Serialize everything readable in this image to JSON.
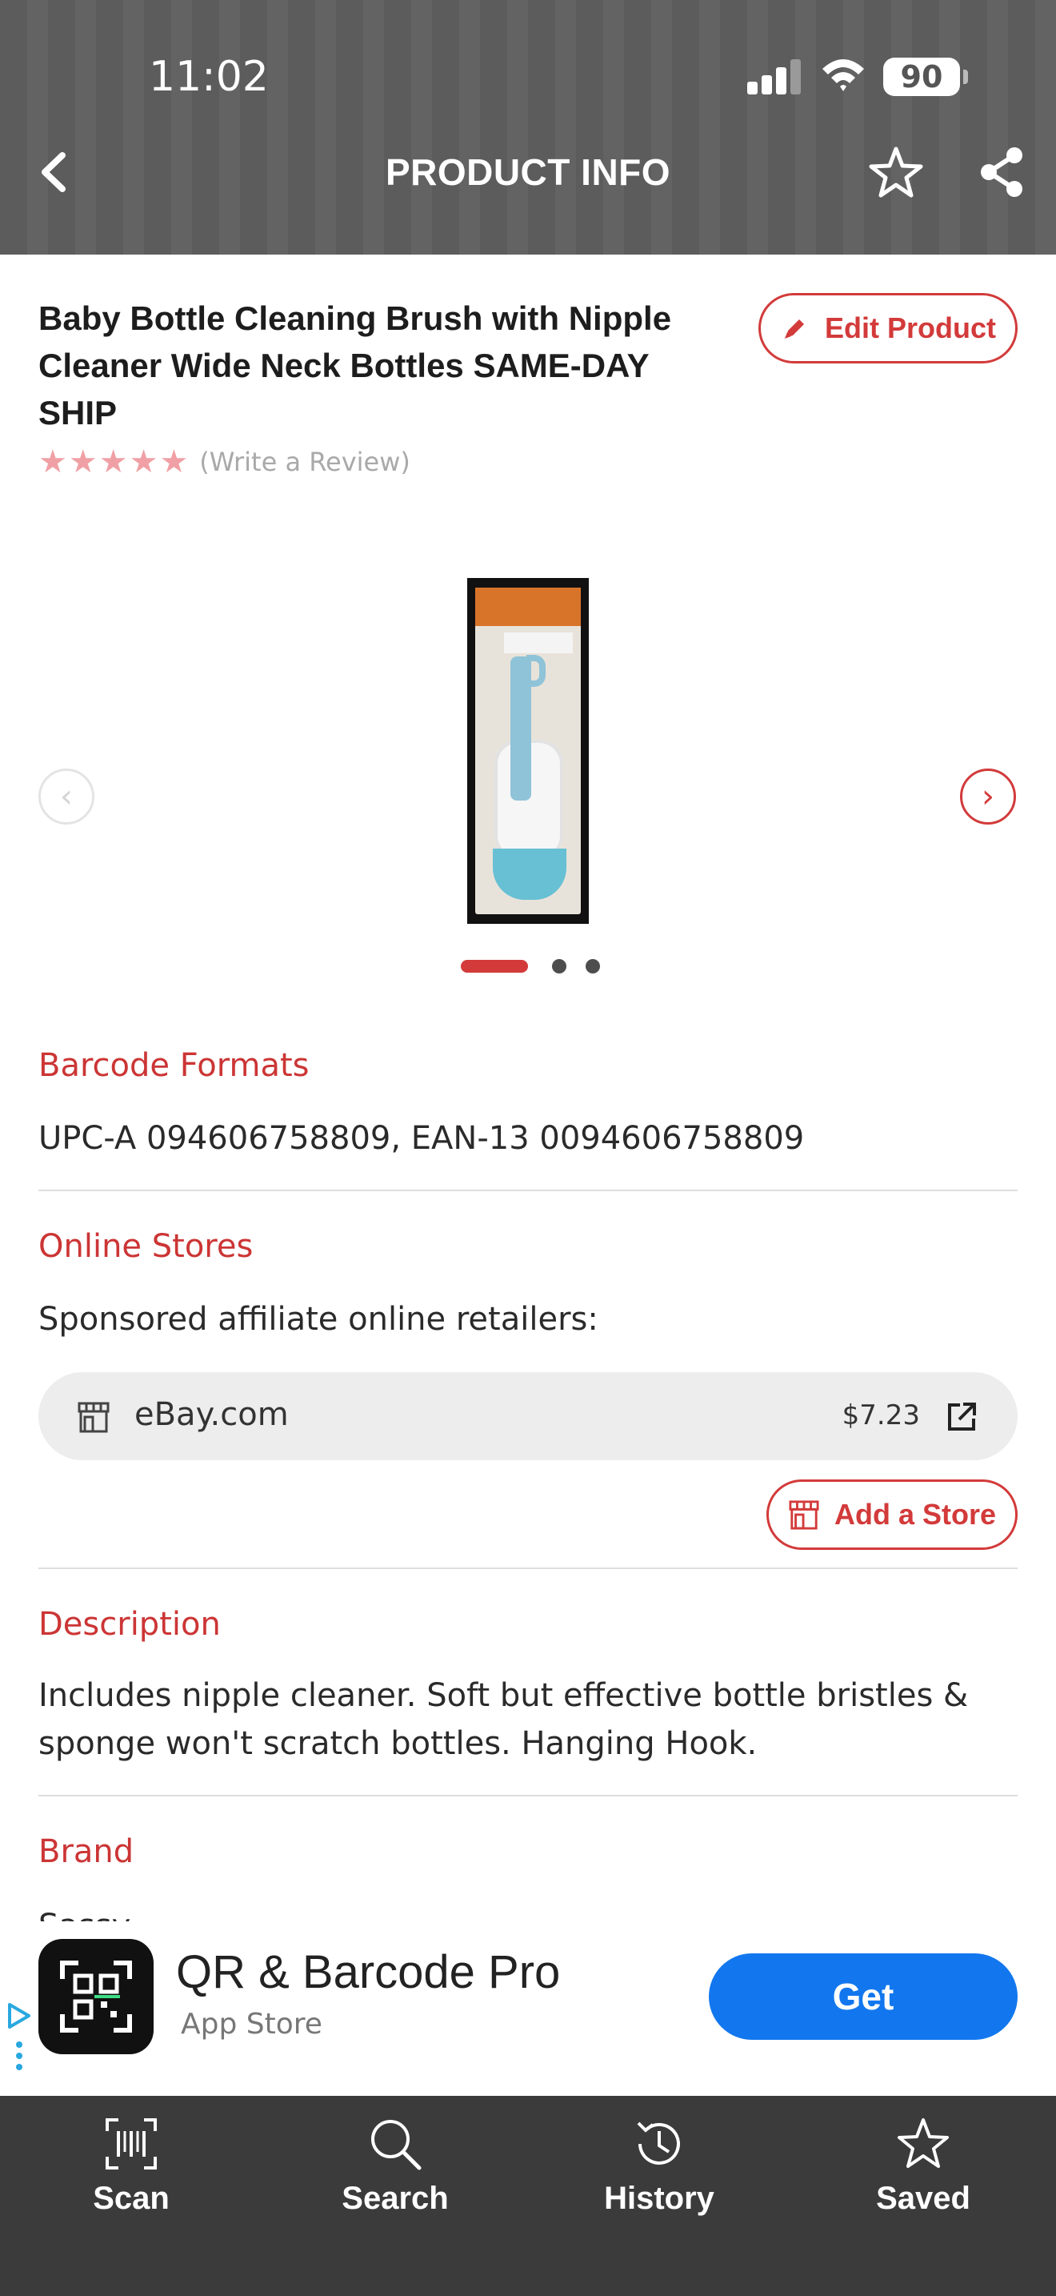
{
  "status_bar": {
    "time": "11:02",
    "battery": "90"
  },
  "header": {
    "title": "PRODUCT INFO"
  },
  "product": {
    "title": "Baby Bottle Cleaning Brush with Nipple Cleaner Wide Neck Bottles SAME-DAY SHIP",
    "edit_label": "Edit Product",
    "rating_stars": 5,
    "review_link": "(Write a Review)"
  },
  "carousel": {
    "total_images": 3,
    "current_index": 1
  },
  "barcode": {
    "label": "Barcode Formats",
    "value": "UPC-A 094606758809, EAN-13 0094606758809"
  },
  "stores": {
    "label": "Online Stores",
    "subtitle": "Sponsored affiliate online retailers:",
    "items": [
      {
        "name": "eBay.com",
        "price": "$7.23"
      }
    ],
    "add_label": "Add a Store"
  },
  "description": {
    "label": "Description",
    "text": "Includes nipple cleaner. Soft but effective bottle bristles & sponge won't scratch bottles. Hanging Hook."
  },
  "brand": {
    "label": "Brand",
    "value_partial": "Sassy"
  },
  "ad": {
    "app_name": "QR & Barcode Pro",
    "store": "App Store",
    "cta": "Get"
  },
  "tabs": [
    {
      "label": "Scan",
      "icon": "scan-icon"
    },
    {
      "label": "Search",
      "icon": "search-icon"
    },
    {
      "label": "History",
      "icon": "history-icon"
    },
    {
      "label": "Saved",
      "icon": "star-icon"
    }
  ],
  "colors": {
    "accent": "#d33a3a",
    "tabbar": "#3b3b3b",
    "cta_blue": "#1277ee"
  }
}
